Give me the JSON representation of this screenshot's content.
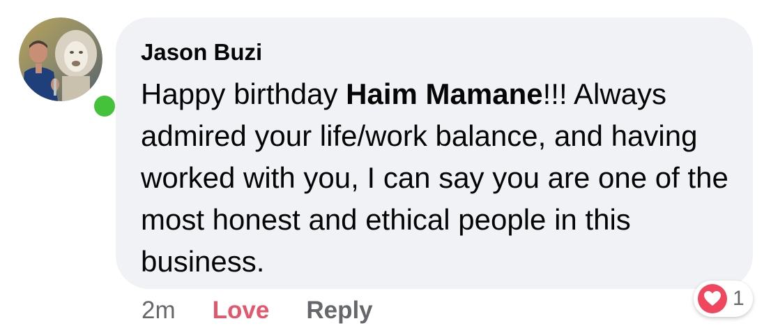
{
  "comment": {
    "author": "Jason Buzi",
    "text_before_mention": "Happy birthday ",
    "mention": "Haim Mamane",
    "text_after_mention": "!!! Always admired your life/work balance, and having worked with you, I can say you are one of the most honest and ethical people in this business.",
    "online": true
  },
  "actions": {
    "timestamp": "2m",
    "love_label": "Love",
    "reply_label": "Reply"
  },
  "reactions": {
    "icon": "heart-icon",
    "count": "1"
  },
  "colors": {
    "bubble_bg": "#f0f2f5",
    "love_active": "#e4566b",
    "secondary_text": "#65676b",
    "presence": "#44c23a",
    "heart": "#f0475e"
  }
}
